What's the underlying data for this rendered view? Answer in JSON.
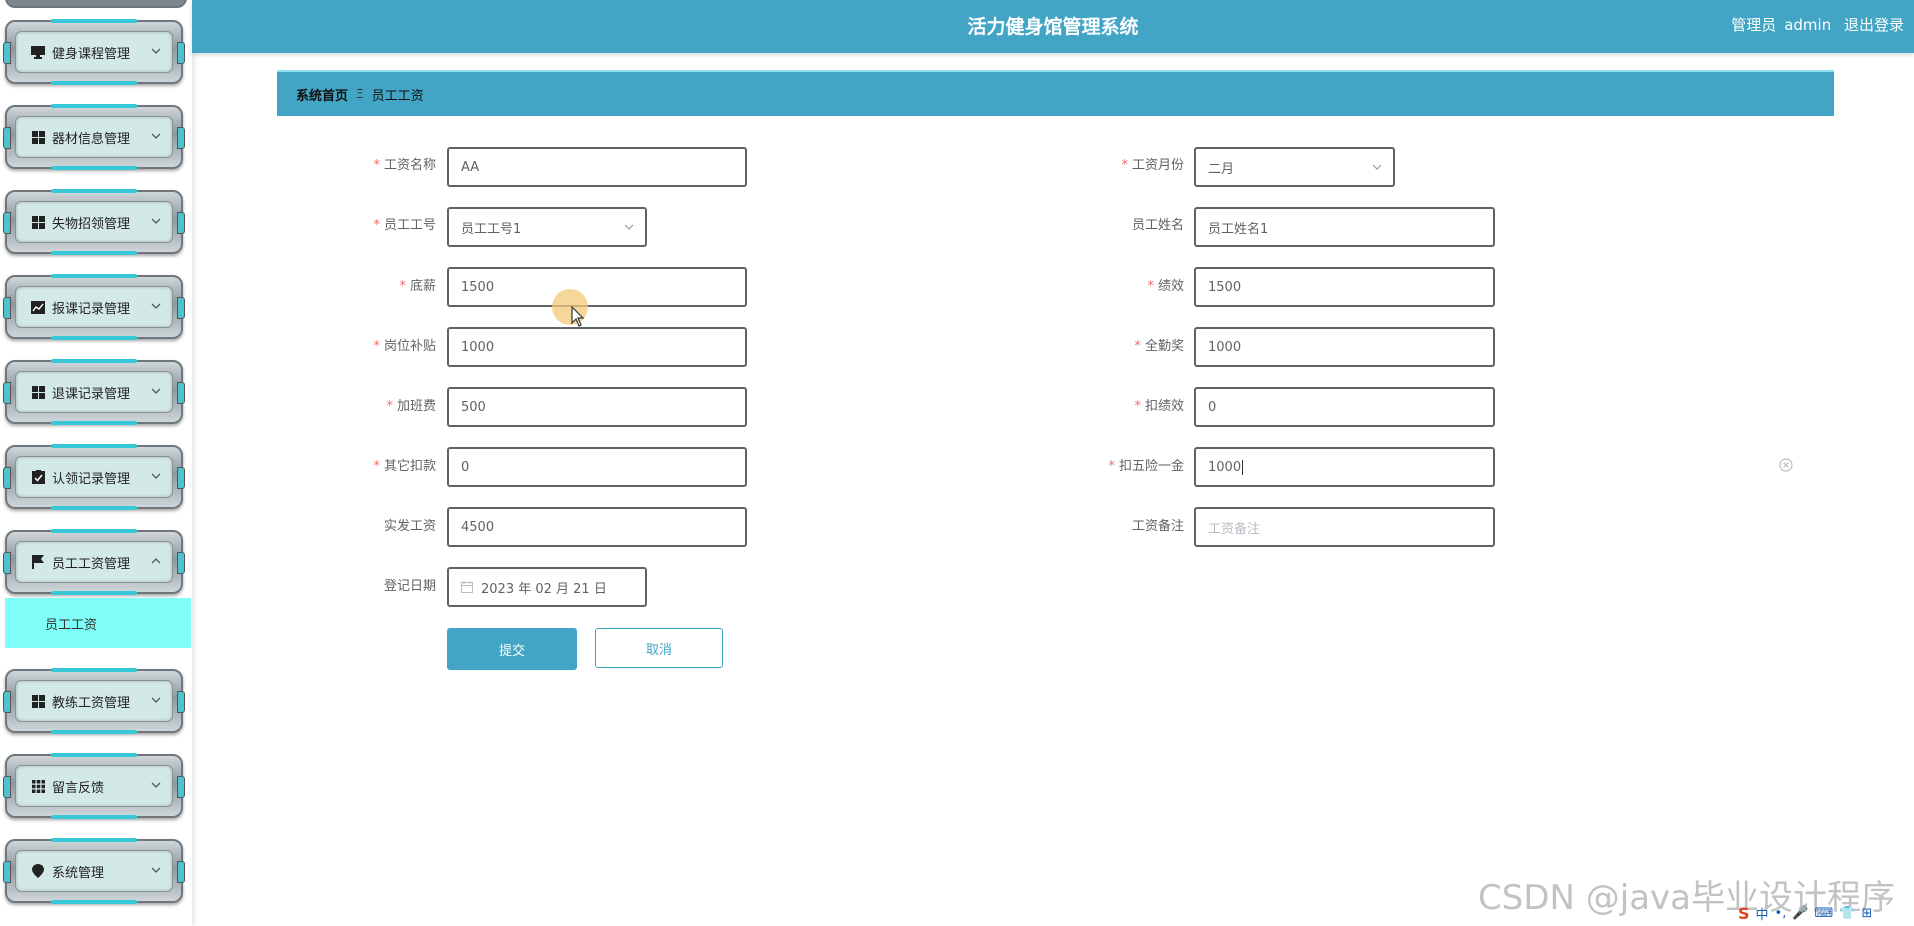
{
  "app": {
    "title": "活力健身馆管理系统",
    "user_role": "管理员",
    "username": "admin",
    "logout_label": "退出登录"
  },
  "colors": {
    "primary": "#42a5c5",
    "submenu_active_bg": "#7ffef8",
    "required": "#f56c6c"
  },
  "sidebar": {
    "items": [
      {
        "label": "健身课程管理",
        "icon": "monitor-icon"
      },
      {
        "label": "器材信息管理",
        "icon": "grid-icon"
      },
      {
        "label": "失物招领管理",
        "icon": "grid-icon"
      },
      {
        "label": "报课记录管理",
        "icon": "chart-icon"
      },
      {
        "label": "退课记录管理",
        "icon": "grid-icon"
      },
      {
        "label": "认领记录管理",
        "icon": "clipboard-check-icon"
      },
      {
        "label": "员工工资管理",
        "icon": "flag-icon",
        "expanded": true
      },
      {
        "label": "教练工资管理",
        "icon": "grid-icon"
      },
      {
        "label": "留言反馈",
        "icon": "apps-icon"
      },
      {
        "label": "系统管理",
        "icon": "location-icon"
      }
    ],
    "active_sub": "员工工资"
  },
  "breadcrumb": {
    "home": "系统首页",
    "separator": "Ξ",
    "current": "员工工资"
  },
  "form": {
    "salary_name": {
      "label": "工资名称",
      "value": "AA"
    },
    "salary_month": {
      "label": "工资月份",
      "value": "二月"
    },
    "employee_no": {
      "label": "员工工号",
      "value": "员工工号1"
    },
    "employee_name": {
      "label": "员工姓名",
      "value": "员工姓名1"
    },
    "base_salary": {
      "label": "底薪",
      "value": "1500"
    },
    "performance": {
      "label": "绩效",
      "value": "1500"
    },
    "post_allowance": {
      "label": "岗位补贴",
      "value": "1000"
    },
    "attendance_bonus": {
      "label": "全勤奖",
      "value": "1000"
    },
    "overtime_pay": {
      "label": "加班费",
      "value": "500"
    },
    "performance_deduction": {
      "label": "扣绩效",
      "value": "0"
    },
    "other_deduction": {
      "label": "其它扣款",
      "value": "0"
    },
    "insurance_deduction": {
      "label": "扣五险一金",
      "value": "1000"
    },
    "net_salary": {
      "label": "实发工资",
      "value": "4500"
    },
    "salary_note": {
      "label": "工资备注",
      "placeholder": "工资备注"
    },
    "register_date": {
      "label": "登记日期",
      "value": "2023 年 02 月 21 日"
    },
    "submit_label": "提交",
    "cancel_label": "取消"
  },
  "watermark": "CSDN @java毕业设计程序",
  "ime": {
    "brand": "S",
    "items": [
      "中",
      "•,",
      "🎤",
      "⌨",
      "👕",
      "⊞"
    ]
  }
}
